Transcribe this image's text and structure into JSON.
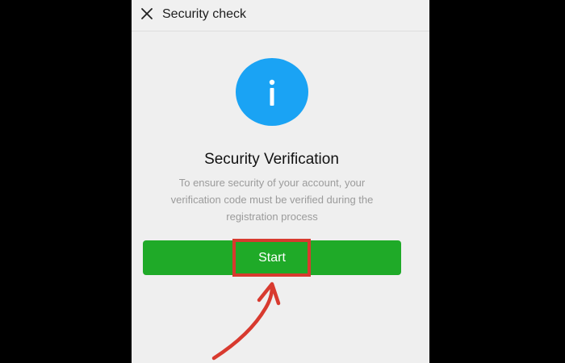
{
  "header": {
    "title": "Security check",
    "close_icon": "close-icon"
  },
  "main": {
    "badge_icon": "info-icon",
    "badge_color": "#1aa3f4",
    "heading": "Security Verification",
    "description": "To ensure security of your account, your verification code must be verified during the registration process",
    "start_button": {
      "label": "Start",
      "color": "#1faa28"
    }
  },
  "annotation": {
    "highlight_color": "#d83a2f",
    "arrow_icon": "hand-drawn-arrow-icon"
  }
}
